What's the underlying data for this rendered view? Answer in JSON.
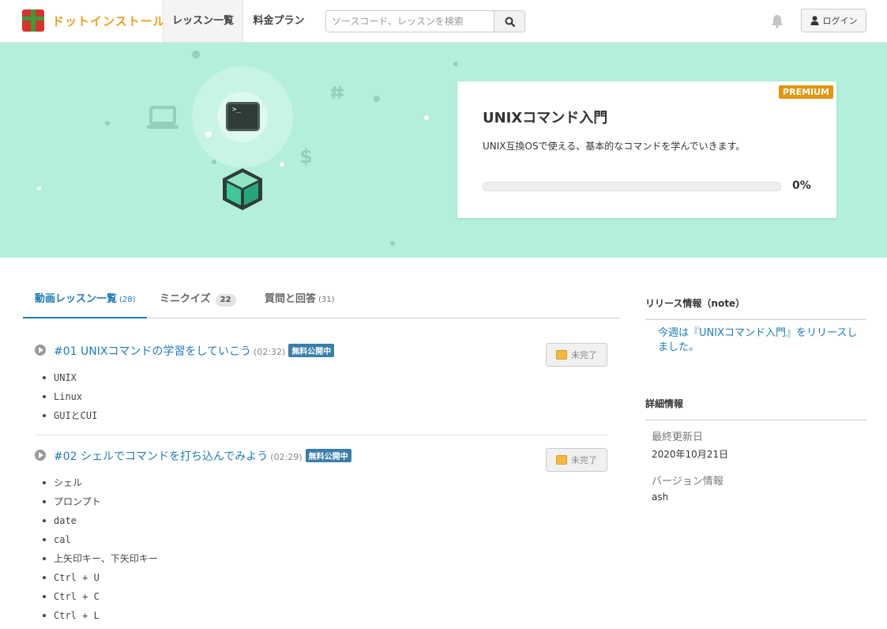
{
  "header": {
    "logo_text": "ドットインストール",
    "nav": {
      "lessons": "レッスン一覧",
      "pricing": "料金プラン"
    },
    "search": {
      "placeholder": "ソースコード、レッスンを検索"
    },
    "login_label": "ログイン"
  },
  "hero": {
    "badge": "PREMIUM",
    "course_title": "UNIXコマンド入門",
    "course_description": "UNIX互換OSで使える、基本的なコマンドを学んでいきます。",
    "progress_fraction": 0,
    "progress_label": "0%"
  },
  "tabs": [
    {
      "label": "動画レッスン一覧",
      "count": "(28)"
    },
    {
      "label": "ミニクイズ",
      "count": "22"
    },
    {
      "label": "質問と回答",
      "count": "(31)"
    }
  ],
  "lessons": [
    {
      "title": "#01 UNIXコマンドの学習をしていこう",
      "duration": "(02:32)",
      "badge": "無料公開中",
      "status": "未完了",
      "topics": [
        "UNIX",
        "Linux",
        "GUIとCUI"
      ]
    },
    {
      "title": "#02 シェルでコマンドを打ち込んでみよう",
      "duration": "(02:29)",
      "badge": "無料公開中",
      "status": "未完了",
      "topics": [
        "シェル",
        "プロンプト",
        "date",
        "cal",
        "上矢印キー、下矢印キー",
        "Ctrl + U",
        "Ctrl + C",
        "Ctrl + L"
      ]
    }
  ],
  "sidebar": {
    "release_heading": "リリース情報（note）",
    "release_text": "今週は『UNIXコマンド入門』をリリースしました。",
    "detail_heading": "詳細情報",
    "updated_label": "最終更新日",
    "updated_value": "2020年10月21日",
    "version_label": "バージョン情報",
    "version_value": "ash"
  },
  "colors": {
    "hero_bg": "#b3efdc",
    "link": "#1f7cb8",
    "premium": "#e1960e",
    "free_badge": "#3a7fa9"
  }
}
